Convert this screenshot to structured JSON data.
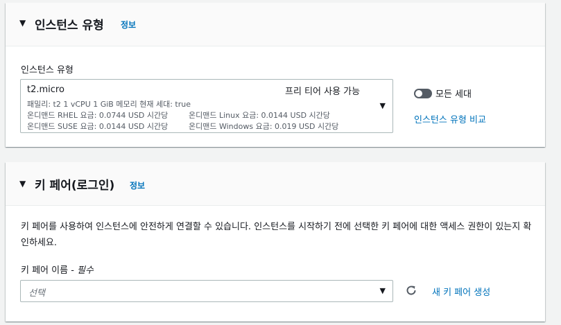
{
  "instance_section": {
    "title": "인스턴스 유형",
    "info_link": "정보",
    "field_label": "인스턴스 유형",
    "selected": {
      "name": "t2.micro",
      "badge": "프리 티어 사용 가능",
      "details_line1": "패밀리: t2    1 vCPU    1 GiB 메모리    현재 세대: true",
      "details_line2a": "온디맨드 RHEL 요금: 0.0744 USD 시간당",
      "details_line2b": "온디맨드 Linux 요금: 0.0144 USD 시간당",
      "details_line3a": "온디맨드 SUSE 요금: 0.0144 USD 시간당",
      "details_line3b": "온디맨드 Windows 요금: 0.019 USD 시간당"
    },
    "toggle_label": "모든 세대",
    "toggle_on": false,
    "compare_link": "인스턴스 유형 비교"
  },
  "keypair_section": {
    "title": "키 페어(로그인)",
    "info_link": "정보",
    "description": "키 페어를 사용하여 인스턴스에 안전하게 연결할 수 있습니다. 인스턴스를 시작하기 전에 선택한 키 페어에 대한 액세스 권한이 있는지 확인하세요.",
    "field_label": "키 페어 이름 - ",
    "required_label": "필수",
    "select_placeholder": "선택",
    "create_link": "새 키 페어 생성"
  }
}
